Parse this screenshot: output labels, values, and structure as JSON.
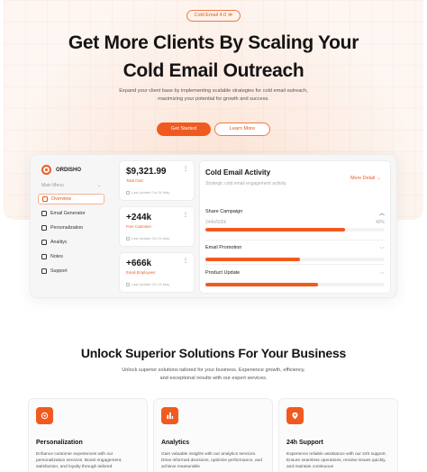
{
  "hero": {
    "badge": "Cold Email 4.0 ≫",
    "title_line1": "Get More Clients By Scaling Your",
    "title_line2": "Cold Email Outreach",
    "subtitle_line1": "Expand your client base by implementing scalable strategies for cold email outreach,",
    "subtitle_line2": "maximizing your potential for growth and success.",
    "primary_button": "Get Started",
    "secondary_button": "Learn More"
  },
  "dashboard": {
    "brand": "ORDISHO",
    "menu_header": "Main Menu",
    "menu": [
      {
        "label": "Overview",
        "icon": "home-icon",
        "active": true
      },
      {
        "label": "Email Generator",
        "icon": "mail-icon"
      },
      {
        "label": "Personalization",
        "icon": "user-icon"
      },
      {
        "label": "Analityc",
        "icon": "chart-icon"
      },
      {
        "label": "Notes",
        "icon": "note-icon"
      },
      {
        "label": "Support",
        "icon": "headset-icon"
      }
    ],
    "stats": [
      {
        "value": "$9,321.99",
        "label": "Total Cost",
        "footer": "Last Update On 24 May"
      },
      {
        "value": "+244k",
        "label": "Free Customer",
        "footer": "Last Update On 24 May"
      },
      {
        "value": "+666k",
        "label": "Email Employees",
        "footer": "Last Update On 24 May"
      }
    ],
    "activity": {
      "title": "Cold Email Activity",
      "subtitle": "Strategic cold email engagement activity.",
      "link": "More Detail →",
      "rows": [
        {
          "label": "Share Campaign",
          "meta_left": "244k/500k",
          "meta_right": "40%",
          "progress": 0.78,
          "expanded": true
        },
        {
          "label": "Email Promotion",
          "progress": 0.53,
          "expanded": false
        },
        {
          "label": "Product Update",
          "progress": 0.63,
          "expanded": false
        }
      ]
    }
  },
  "solutions": {
    "title": "Unlock Superior Solutions For Your Business",
    "subtitle_line1": "Unlock superior solutions tailored for your business. Experience growth, efficiency,",
    "subtitle_line2": "and exceptional results with our expert services.",
    "features": [
      {
        "title": "Personalization",
        "icon": "user-icon",
        "desc": "Enhance customer experiences with our personalization services. Boost engagement, satisfaction, and loyalty through tailored"
      },
      {
        "title": "Analytics",
        "icon": "chart-icon",
        "desc": "Gain valuable insights with our analytics services. Drive informed decisions, optimize performance, and achieve measurable"
      },
      {
        "title": "24h Support",
        "icon": "location-icon",
        "desc": "Experience reliable assistance with our 24h support. Ensure seamless operations, resolve issues quickly, and maintain continuous"
      }
    ]
  },
  "colors": {
    "accent": "#f05a1f",
    "accent_soft": "#fcebe1"
  }
}
